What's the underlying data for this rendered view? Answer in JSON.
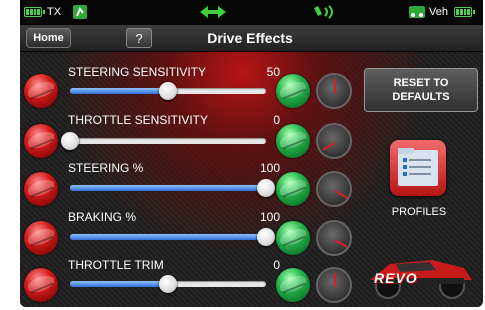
{
  "statusbar": {
    "tx_label": "TX",
    "veh_label": "Veh"
  },
  "header": {
    "home_label": "Home",
    "help_label": "?",
    "title": "Drive Effects"
  },
  "settings": [
    {
      "label": "STEERING SENSITIVITY",
      "value": "50",
      "level": 0.5
    },
    {
      "label": "THROTTLE SENSITIVITY",
      "value": "0",
      "level": 0
    },
    {
      "label": "STEERING %",
      "value": "100",
      "level": 1
    },
    {
      "label": "BRAKING %",
      "value": "100",
      "level": 1
    },
    {
      "label": "THROTTLE TRIM",
      "value": "0",
      "level": 0.5
    }
  ],
  "side": {
    "reset_label_1": "RESET TO",
    "reset_label_2": "DEFAULTS",
    "profiles_label": "PROFILES",
    "vehicle_logo": "REVO"
  },
  "colors": {
    "accent_red": "#d11a1a",
    "accent_green": "#22b34a",
    "slider_blue": "#2f6fd6"
  },
  "icons": [
    "battery-icon",
    "transmitter-icon",
    "link-arrows-icon",
    "signal-icon",
    "vehicle-icon",
    "profiles-icon"
  ]
}
